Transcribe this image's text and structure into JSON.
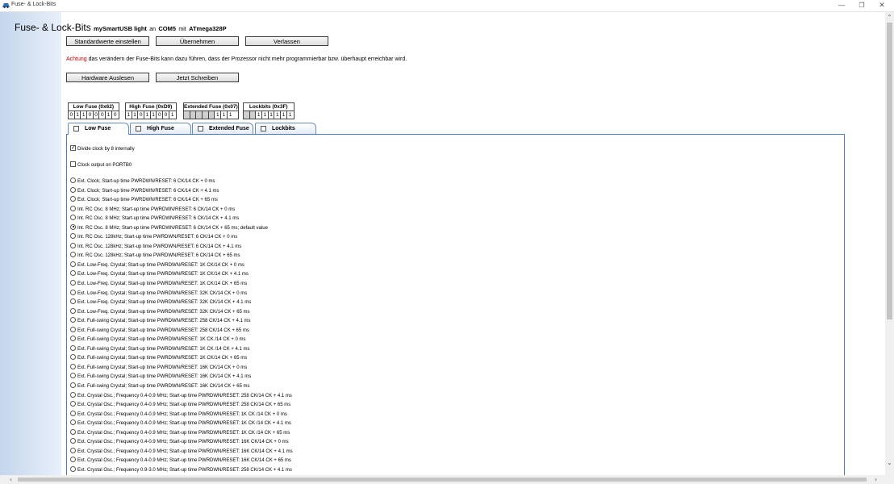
{
  "window": {
    "title": "Fuse- & Lock-Bits",
    "minimize_glyph": "—",
    "restore_glyph": "❐",
    "close_glyph": "✕"
  },
  "header": {
    "title": "Fuse- & Lock-Bits",
    "device": "mySmartUSB light",
    "on": "an",
    "port": "COM5",
    "with": "mit",
    "chip": "ATmega328P"
  },
  "toolbar": {
    "defaults_label": "Standardwerte einstellen",
    "apply_label": "Übernehmen",
    "exit_label": "Verlassen",
    "read_label": "Hardware Auslesen",
    "write_label": "Jetzt Schreiben"
  },
  "warning": {
    "prefix": "Achtung",
    "text": " das verändern der Fuse-Bits kann dazu führen, dass der Prozessor nicht mehr programmierbar bzw. überhaupt erreichbar wird."
  },
  "fuses": [
    {
      "label": "Low Fuse (0x62)",
      "bits": [
        "0",
        "1",
        "1",
        "0",
        "0",
        "0",
        "1",
        "0"
      ]
    },
    {
      "label": "High Fuse (0xD9)",
      "bits": [
        "1",
        "1",
        "0",
        "1",
        "1",
        "0",
        "0",
        "1"
      ]
    },
    {
      "label": "Extended Fuse (0x07)",
      "bits": [
        "",
        "",
        "",
        "",
        "",
        "1",
        "1",
        "1"
      ]
    },
    {
      "label": "Lockbits (0x3F)",
      "bits": [
        "",
        "",
        "1",
        "1",
        "1",
        "1",
        "1",
        "1"
      ]
    }
  ],
  "tabs": [
    "Low Fuse",
    "High Fuse",
    "Extended Fuse",
    "Lockbits"
  ],
  "options": {
    "divide_clock": {
      "label": "Divide clock by 8 internally",
      "checked": true
    },
    "clock_output": {
      "label": "Clock output on PORTB0",
      "checked": false
    }
  },
  "clock_options": [
    "Ext. Clock; Start-up time PWRDWN/RESET: 6 CK/14 CK + 0 ms",
    "Ext. Clock; Start-up time PWRDWN/RESET: 6 CK/14 CK + 4.1 ms",
    "Ext. Clock; Start-up time PWRDWN/RESET: 6 CK/14 CK + 65 ms",
    "Int. RC Osc. 8 MHz; Start-up time PWRDWN/RESET: 6 CK/14 CK + 0 ms",
    "Int. RC Osc. 8 MHz; Start-up time PWRDWN/RESET: 6 CK/14 CK + 4.1 ms",
    "Int. RC Osc. 8 MHz; Start-up time PWRDWN/RESET: 6 CK/14 CK + 65 ms; default value",
    "Int. RC Osc. 128kHz; Start-up time PWRDWN/RESET: 6 CK/14 CK + 0 ms",
    "Int. RC Osc. 128kHz; Start-up time PWRDWN/RESET: 6 CK/14 CK + 4.1 ms",
    "Int. RC Osc. 128kHz; Start-up time PWRDWN/RESET: 6 CK/14 CK + 65 ms",
    "Ext. Low-Freq. Crystal; Start-up time PWRDWN/RESET: 1K CK/14 CK + 0 ms",
    "Ext. Low-Freq. Crystal; Start-up time PWRDWN/RESET: 1K CK/14 CK + 4.1 ms",
    "Ext. Low-Freq. Crystal; Start-up time PWRDWN/RESET: 1K CK/14 CK + 65 ms",
    "Ext. Low-Freq. Crystal; Start-up time PWRDWN/RESET: 32K CK/14 CK + 0 ms",
    "Ext. Low-Freq. Crystal; Start-up time PWRDWN/RESET: 32K CK/14 CK + 4.1 ms",
    "Ext. Low-Freq. Crystal; Start-up time PWRDWN/RESET: 32K CK/14 CK + 65 ms",
    "Ext. Full-swing Crystal; Start-up time PWRDWN/RESET: 258 CK/14 CK + 4.1 ms",
    "Ext. Full-swing Crystal; Start-up time PWRDWN/RESET: 258 CK/14 CK + 65 ms",
    "Ext. Full-swing Crystal; Start-up time PWRDWN/RESET: 1K CK /14 CK + 0 ms",
    "Ext. Full-swing Crystal; Start-up time PWRDWN/RESET: 1K CK /14 CK + 4.1 ms",
    "Ext. Full-swing Crystal; Start-up time PWRDWN/RESET: 1K CK/14 CK + 65 ms",
    "Ext. Full-swing Crystal; Start-up time PWRDWN/RESET: 16K CK/14 CK + 0 ms",
    "Ext. Full-swing Crystal; Start-up time PWRDWN/RESET: 16K CK/14 CK + 4.1 ms",
    "Ext. Full-swing Crystal; Start-up time PWRDWN/RESET: 16K CK/14 CK + 65 ms",
    "Ext. Crystal Osc.; Frequency 0.4-0.9 MHz; Start-up time PWRDWN/RESET: 258 CK/14 CK + 4.1 ms",
    "Ext. Crystal Osc.; Frequency 0.4-0.9 MHz; Start-up time PWRDWN/RESET: 258 CK/14 CK + 65 ms",
    "Ext. Crystal Osc.; Frequency 0.4-0.9 MHz; Start-up time PWRDWN/RESET: 1K CK /14 CK + 0 ms",
    "Ext. Crystal Osc.; Frequency 0.4-0.9 MHz; Start-up time PWRDWN/RESET: 1K CK /14 CK + 4.1 ms",
    "Ext. Crystal Osc.; Frequency 0.4-0.9 MHz; Start-up time PWRDWN/RESET: 1K CK /14 CK + 65 ms",
    "Ext. Crystal Osc.; Frequency 0.4-0.9 MHz; Start-up time PWRDWN/RESET: 16K CK/14 CK + 0 ms",
    "Ext. Crystal Osc.; Frequency 0.4-0.9 MHz; Start-up time PWRDWN/RESET: 16K CK/14 CK + 4.1 ms",
    "Ext. Crystal Osc.; Frequency 0.4-0.9 MHz; Start-up time PWRDWN/RESET: 16K CK/14 CK + 65 ms",
    "Ext. Crystal Osc.; Frequency 0.9-3.0 MHz; Start-up time PWRDWN/RESET: 258 CK/14 CK + 4.1 ms"
  ],
  "selected_clock_option": 5,
  "scroll": {
    "up": "⌃",
    "down": "⌄",
    "left": "‹",
    "right": "›"
  }
}
